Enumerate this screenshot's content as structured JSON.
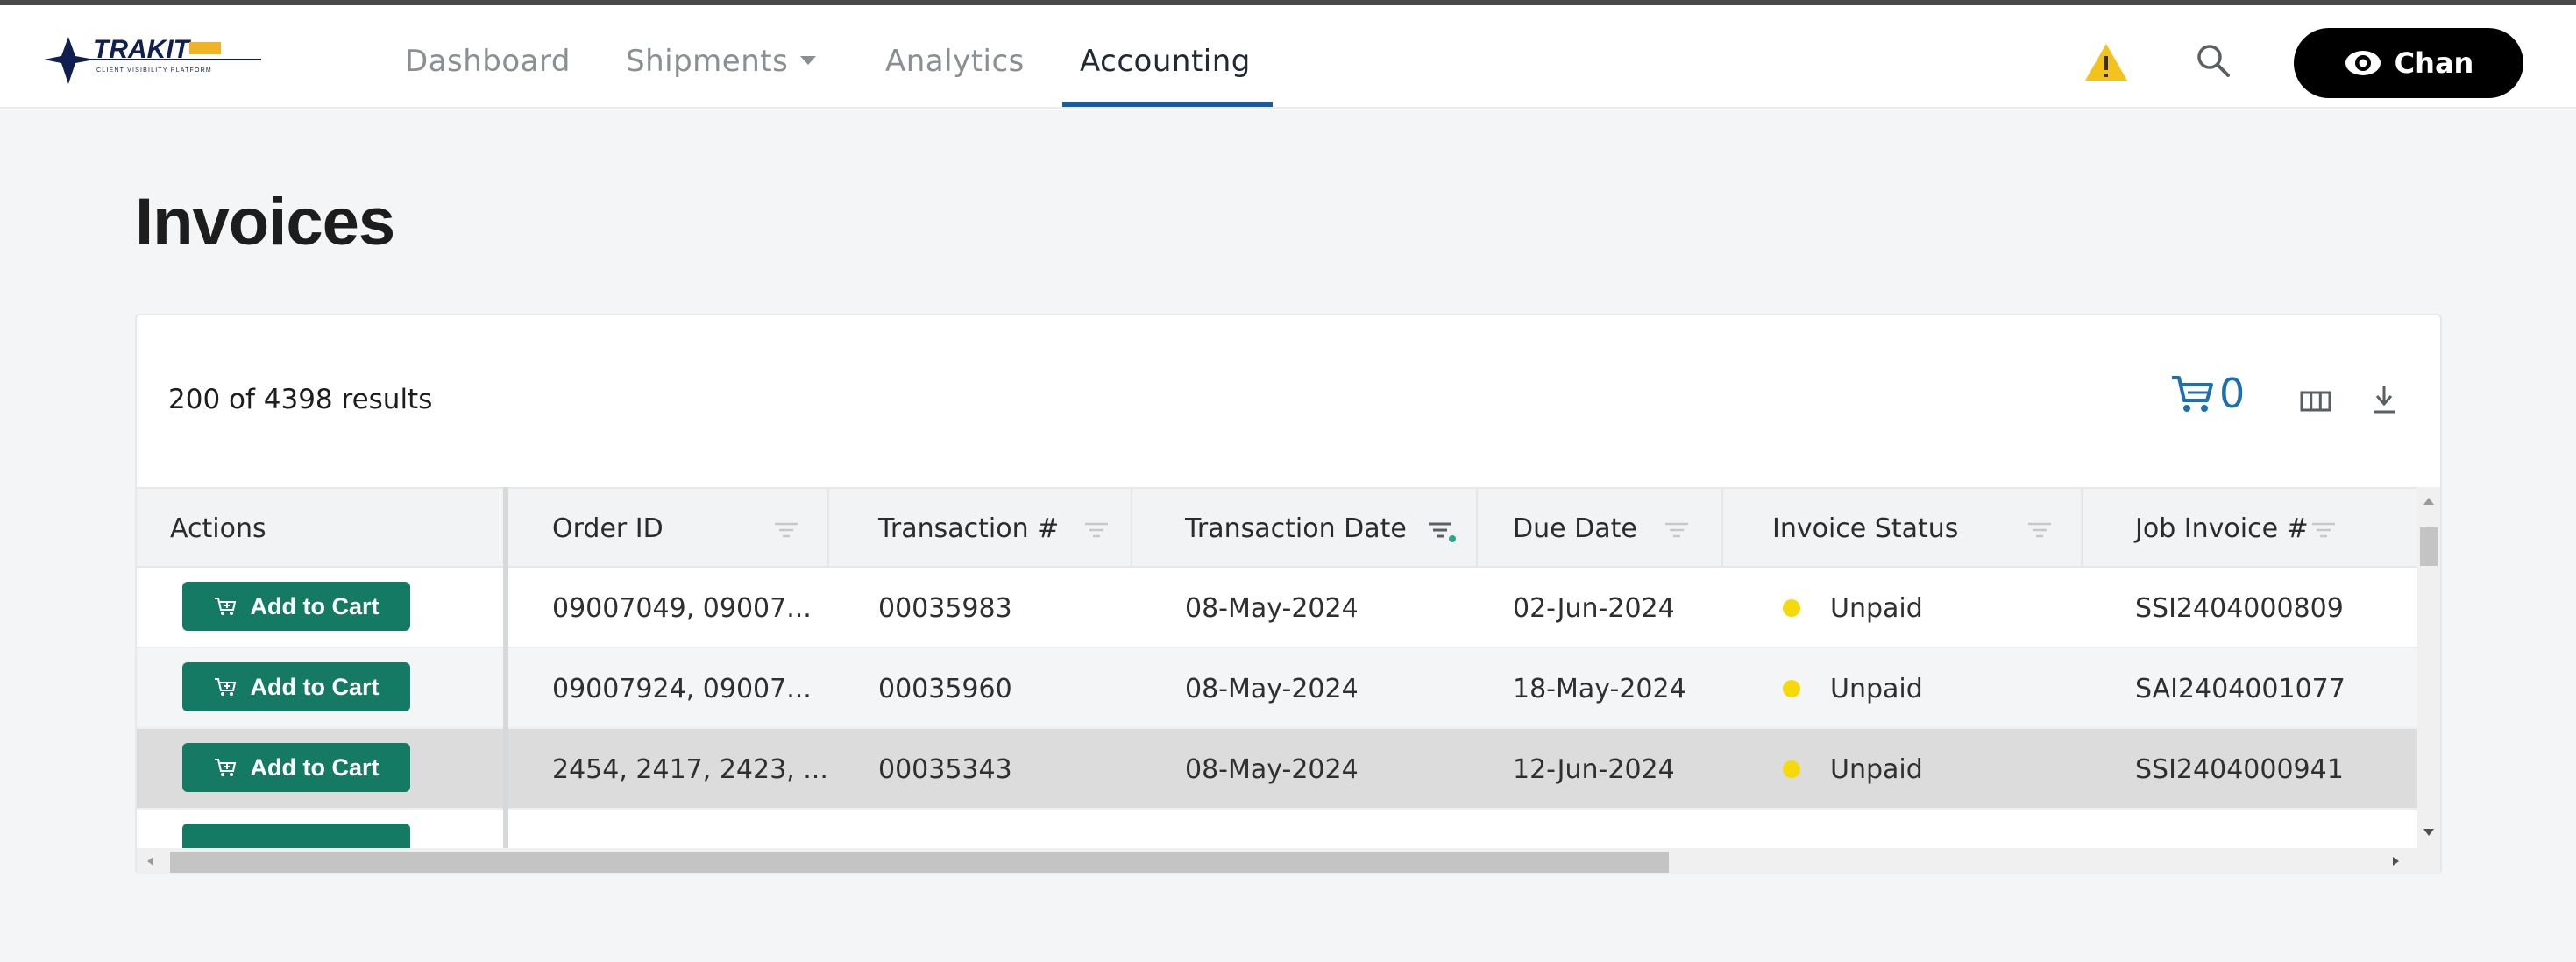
{
  "header": {
    "logo": {
      "text": "TRAKIT",
      "tagline": "CLIENT VISIBILITY PLATFORM"
    },
    "nav": [
      {
        "label": "Dashboard",
        "active": false
      },
      {
        "label": "Shipments",
        "active": false,
        "has_dropdown": true
      },
      {
        "label": "Analytics",
        "active": false
      },
      {
        "label": "Accounting",
        "active": true
      }
    ],
    "icons": [
      "warning-icon",
      "search-icon"
    ],
    "user_button_label": "Chan"
  },
  "page": {
    "title": "Invoices"
  },
  "card": {
    "results_text": "200 of 4398 results",
    "cart_count": "0",
    "toolbar_icons": [
      "cart-icon",
      "columns-icon",
      "download-icon"
    ]
  },
  "table": {
    "columns": [
      "Actions",
      "Order ID",
      "Transaction #",
      "Transaction Date",
      "Due Date",
      "Invoice Status",
      "Job Invoice #"
    ],
    "action_label": "Add to Cart",
    "rows": [
      {
        "order_id": "09007049, 09007...",
        "transaction": "00035983",
        "transaction_date": "08-May-2024",
        "due_date": "02-Jun-2024",
        "status": "Unpaid",
        "job_invoice": "SSI2404000809"
      },
      {
        "order_id": "09007924, 09007...",
        "transaction": "00035960",
        "transaction_date": "08-May-2024",
        "due_date": "18-May-2024",
        "status": "Unpaid",
        "job_invoice": "SAI2404001077"
      },
      {
        "order_id": "2454, 2417, 2423, ...",
        "transaction": "00035343",
        "transaction_date": "08-May-2024",
        "due_date": "12-Jun-2024",
        "status": "Unpaid",
        "job_invoice": "SSI2404000941"
      }
    ]
  },
  "colors": {
    "accent_nav_underline": "#1a5aa0",
    "add_to_cart_button": "#147a63",
    "status_unpaid_dot": "#f5d90a",
    "warning_icon": "#f3c21b",
    "cart_count": "#1d6fb3"
  }
}
